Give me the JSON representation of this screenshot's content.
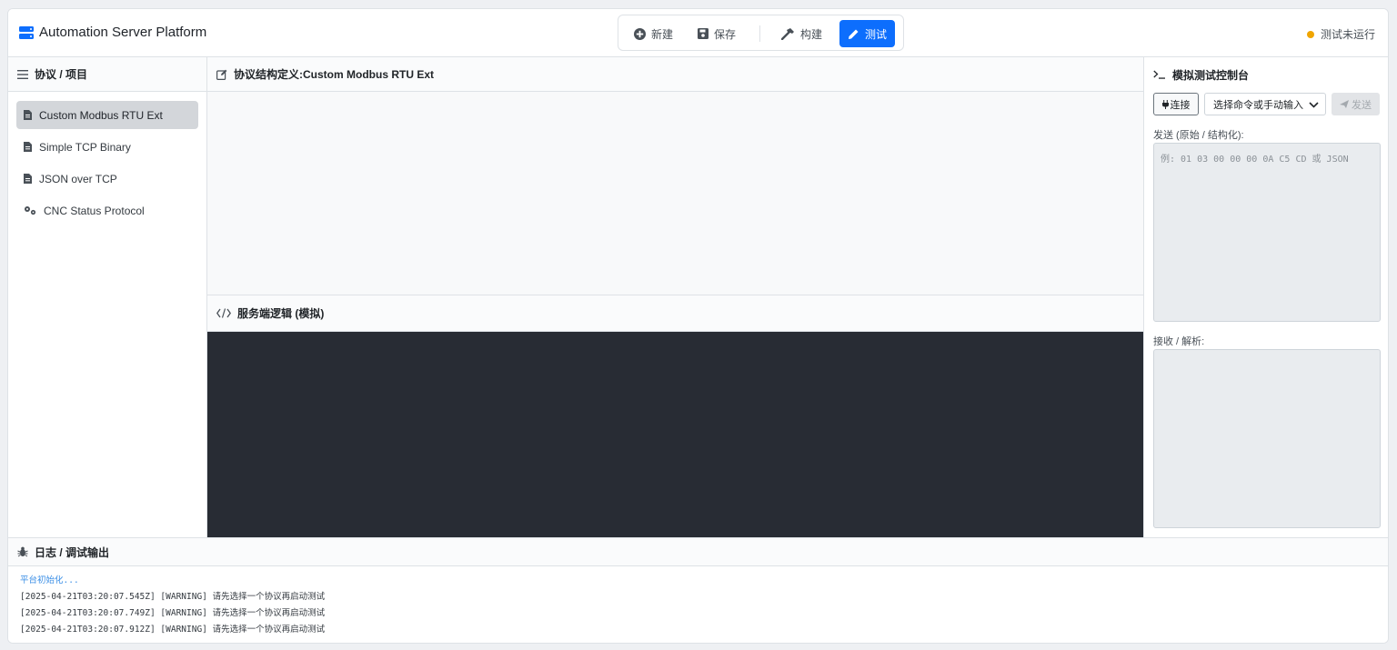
{
  "app": {
    "title": "Automation Server Platform"
  },
  "toolbar": {
    "new_label": "新建",
    "save_label": "保存",
    "build_label": "构建",
    "test_label": "测试"
  },
  "status": {
    "text": "测试未运行",
    "color": "#f0a500"
  },
  "sidebar": {
    "title": "协议 / 项目",
    "items": [
      {
        "label": "Custom Modbus RTU Ext",
        "icon": "file-icon",
        "selected": true
      },
      {
        "label": "Simple TCP Binary",
        "icon": "file-icon",
        "selected": false
      },
      {
        "label": "JSON over TCP",
        "icon": "file-icon",
        "selected": false
      },
      {
        "label": "CNC Status Protocol",
        "icon": "gears-icon",
        "selected": false
      }
    ]
  },
  "editor": {
    "title": "协议结构定义:Custom Modbus RTU Ext",
    "logic_title": "服务端逻辑 (模拟)"
  },
  "console": {
    "title": "模拟测试控制台",
    "connect_label": "连接",
    "select_value": "选择命令或手动输入",
    "send_label": "发送",
    "send_field_label": "发送 (原始 / 结构化):",
    "send_placeholder": "例: 01 03 00 00 00 0A C5 CD 或 JSON",
    "receive_label": "接收 / 解析:"
  },
  "log": {
    "title": "日志 / 调试输出",
    "lines": [
      "平台初始化...",
      "[2025-04-21T03:20:07.545Z] [WARNING] 请先选择一个协议再启动测试",
      "[2025-04-21T03:20:07.749Z] [WARNING] 请先选择一个协议再启动测试",
      "[2025-04-21T03:20:07.912Z] [WARNING] 请先选择一个协议再启动测试"
    ]
  },
  "colors": {
    "accent": "#0d6efd",
    "code_bg": "#282c34",
    "warning": "#f0a500"
  }
}
